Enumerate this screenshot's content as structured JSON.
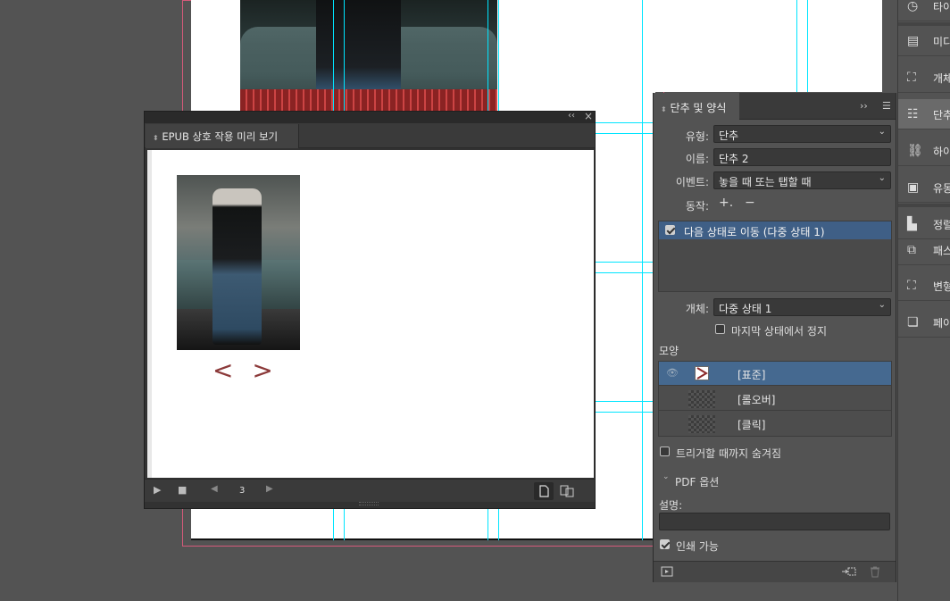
{
  "epub_panel": {
    "tab_label": "EPUB 상호 작용 미리 보기",
    "page_number": "3",
    "collapse_glyph": "‹‹",
    "close_glyph": "×",
    "preview_arrows": "< >"
  },
  "buttons_panel": {
    "tab_label": "단추 및 양식",
    "more_glyph": "››",
    "type_label": "유형:",
    "type_value": "단추",
    "name_label": "이름:",
    "name_value": "단추 2",
    "event_label": "이벤트:",
    "event_value": "놓을 때 또는 탭할 때",
    "action_label": "동작:",
    "add_glyph": "+.",
    "remove_glyph": "−",
    "actions": [
      "다음 상태로 이동 (다중 상태 1)"
    ],
    "object_label": "개체:",
    "object_value": "다중 상태 1",
    "stop_label": "마지막 상태에서 정지",
    "appearance_label": "모양",
    "appearances": [
      "[표준]",
      "[롤오버]",
      "[클릭]"
    ],
    "hide_until_label": "트리거할 때까지 숨겨짐",
    "pdf_options_label": "PDF 옵션",
    "description_label": "설명:",
    "description_value": "",
    "printable_label": "인쇄 가능"
  },
  "sidebar": {
    "items": [
      "타이",
      "미디",
      "개체",
      "단추",
      "하이",
      "유동",
      "정렬",
      "패스",
      "변형",
      "페이"
    ]
  },
  "colors": {
    "selection_blue": "#3f5f86",
    "guide_cyan": "#00e5ff",
    "bleed_pink": "#d55a7a",
    "arrow_red": "#8c3a3a"
  }
}
